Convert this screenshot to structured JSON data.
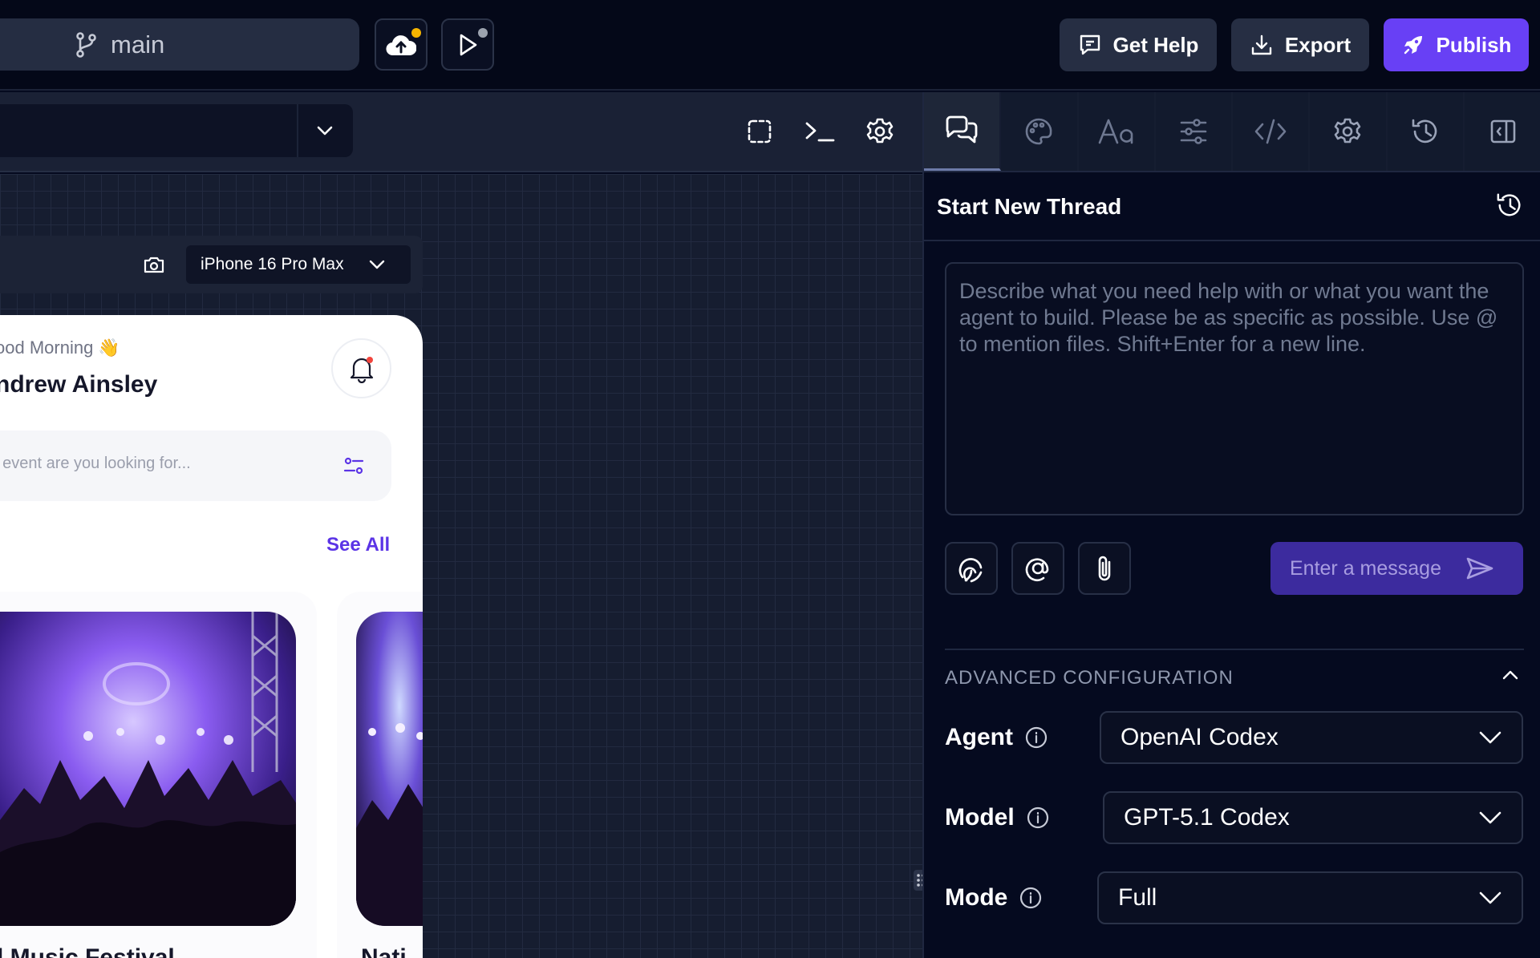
{
  "topbar": {
    "branch_label": "main",
    "get_help_label": "Get Help",
    "export_label": "Export",
    "publish_label": "Publish",
    "cloud_status_color": "#f5b400",
    "run_status_color": "#9ca3af"
  },
  "preview": {
    "device_label": "iPhone 16 Pro Max",
    "greeting": "ood Morning 👋",
    "user_name": "ndrew Ainsley",
    "search_placeholder": "t event are you looking for...",
    "see_all_label": "See All",
    "event_title_1": "l Music Festival",
    "event_title_2": "Nati"
  },
  "panel": {
    "thread_title": "Start New Thread",
    "message_placeholder": "Describe what you need help with or what you want the agent to build. Please be as specific as possible. Use @ to mention files. Shift+Enter for a new line.",
    "send_placeholder": "Enter a message",
    "advanced_title": "ADVANCED CONFIGURATION",
    "agent_label": "Agent",
    "agent_value": "OpenAI Codex",
    "model_label": "Model",
    "model_value": "GPT-5.1 Codex",
    "mode_label": "Mode",
    "mode_value": "Full",
    "accent_color": "#6840f5"
  }
}
